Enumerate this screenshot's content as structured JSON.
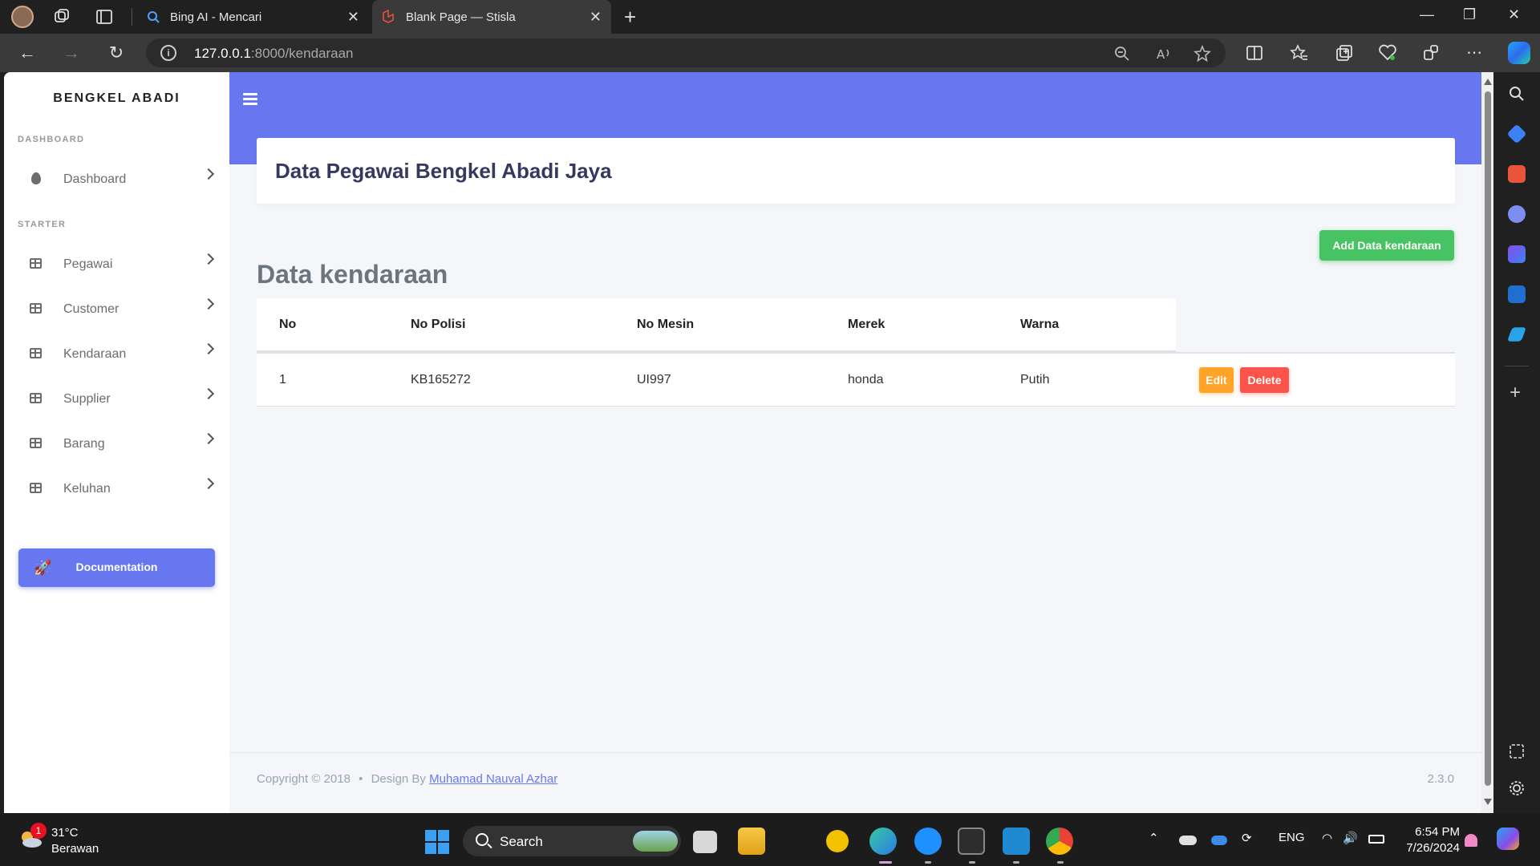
{
  "browser": {
    "tabs": [
      {
        "title": "Bing AI - Mencari"
      },
      {
        "title": "Blank Page — Stisla"
      }
    ],
    "url_host": "127.0.0.1",
    "url_path": ":8000/kendaraan"
  },
  "sidebar": {
    "brand": "BENGKEL ABADI",
    "section_dashboard": "DASHBOARD",
    "dashboard_label": "Dashboard",
    "section_starter": "STARTER",
    "items": [
      {
        "label": "Pegawai"
      },
      {
        "label": "Customer"
      },
      {
        "label": "Kendaraan"
      },
      {
        "label": "Supplier"
      },
      {
        "label": "Barang"
      },
      {
        "label": "Keluhan"
      }
    ],
    "documentation": "Documentation"
  },
  "main": {
    "section_title": "Data Pegawai Bengkel Abadi Jaya",
    "add_button": "Add Data kendaraan",
    "table_title": "Data kendaraan",
    "columns": [
      "No",
      "No Polisi",
      "No Mesin",
      "Merek",
      "Warna"
    ],
    "rows": [
      {
        "no": "1",
        "no_polisi": "KB165272",
        "no_mesin": "UI997",
        "merek": "honda",
        "warna": "Putih"
      }
    ],
    "edit_label": "Edit",
    "delete_label": "Delete"
  },
  "footer": {
    "copyright": "Copyright © 2018",
    "separator": "•",
    "design_by": "Design By",
    "author": "Muhamad Nauval Azhar",
    "version": "2.3.0"
  },
  "taskbar": {
    "temperature": "31°C",
    "condition": "Berawan",
    "weather_badge": "1",
    "search_label": "Search",
    "language": "ENG",
    "time": "6:54 PM",
    "date": "7/26/2024"
  },
  "colors": {
    "primary": "#6777ef",
    "success": "#47c363",
    "warning": "#ffa426",
    "danger": "#fc544b"
  }
}
